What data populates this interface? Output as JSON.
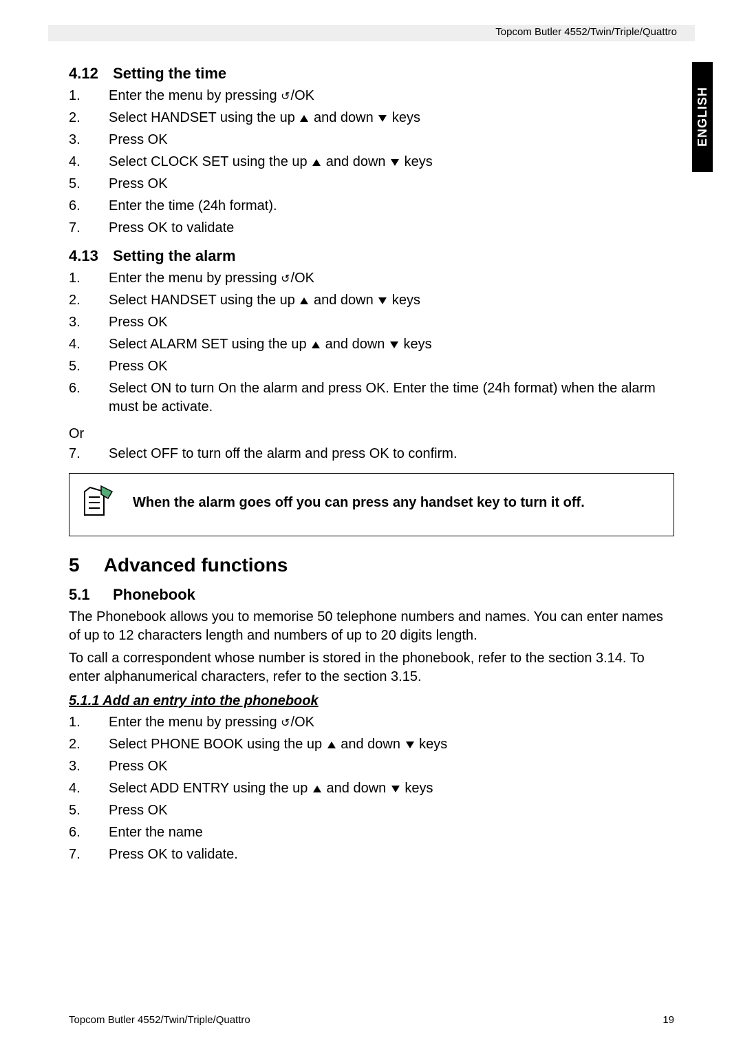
{
  "header": {
    "product": "Topcom Butler 4552/Twin/Triple/Quattro"
  },
  "side_tab": "ENGLISH",
  "s412": {
    "num": "4.12",
    "title": "Setting the time",
    "steps": [
      "Enter the menu by pressing ",
      "Select HANDSET using the up ",
      "Press OK",
      "Select CLOCK SET using the up ",
      "Press OK",
      "Enter the time (24h format).",
      "Press OK to validate"
    ],
    "ok_suffix": "/OK",
    "and_down": " and down ",
    "keys_suffix": " keys"
  },
  "s413": {
    "num": "4.13",
    "title": "Setting the alarm",
    "steps": [
      "Enter the menu by pressing ",
      "Select HANDSET using the up ",
      "Press OK",
      "Select ALARM SET using the up ",
      "Press OK",
      "Select ON to turn On the alarm and press OK.  Enter the time (24h format) when the alarm must be activate."
    ],
    "or": "Or",
    "step7": "Select OFF to turn off the alarm and press OK to confirm."
  },
  "note": "When the alarm goes off you can press any handset key to turn it off.",
  "chapter5": {
    "num": "5",
    "title": "Advanced functions"
  },
  "s51": {
    "num": "5.1",
    "title": "Phonebook",
    "para1": "The Phonebook allows you to memorise 50 telephone numbers and names. You can enter names of up to 12 characters length and numbers of up to 20 digits length.",
    "para2": "To call a correspondent whose number is stored in the phonebook, refer to the section 3.14. To enter alphanumerical characters, refer to the section 3.15."
  },
  "s511": {
    "title": "5.1.1 Add an entry into the phonebook",
    "steps": [
      "Enter the menu by pressing ",
      "Select PHONE BOOK using the up ",
      "Press OK",
      "Select ADD ENTRY using the up ",
      "Press OK",
      "Enter the name",
      "Press OK to validate."
    ]
  },
  "footer": {
    "left": "Topcom Butler 4552/Twin/Triple/Quattro",
    "right": "19"
  }
}
